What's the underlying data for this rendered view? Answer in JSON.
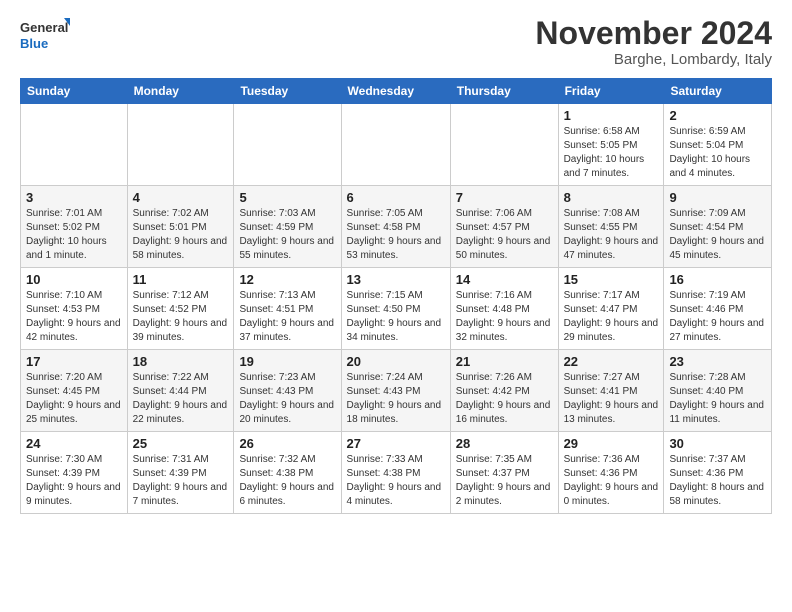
{
  "logo": {
    "line1": "General",
    "line2": "Blue"
  },
  "title": "November 2024",
  "location": "Barghe, Lombardy, Italy",
  "days_header": [
    "Sunday",
    "Monday",
    "Tuesday",
    "Wednesday",
    "Thursday",
    "Friday",
    "Saturday"
  ],
  "weeks": [
    [
      {
        "num": "",
        "info": ""
      },
      {
        "num": "",
        "info": ""
      },
      {
        "num": "",
        "info": ""
      },
      {
        "num": "",
        "info": ""
      },
      {
        "num": "",
        "info": ""
      },
      {
        "num": "1",
        "info": "Sunrise: 6:58 AM\nSunset: 5:05 PM\nDaylight: 10 hours and 7 minutes."
      },
      {
        "num": "2",
        "info": "Sunrise: 6:59 AM\nSunset: 5:04 PM\nDaylight: 10 hours and 4 minutes."
      }
    ],
    [
      {
        "num": "3",
        "info": "Sunrise: 7:01 AM\nSunset: 5:02 PM\nDaylight: 10 hours and 1 minute."
      },
      {
        "num": "4",
        "info": "Sunrise: 7:02 AM\nSunset: 5:01 PM\nDaylight: 9 hours and 58 minutes."
      },
      {
        "num": "5",
        "info": "Sunrise: 7:03 AM\nSunset: 4:59 PM\nDaylight: 9 hours and 55 minutes."
      },
      {
        "num": "6",
        "info": "Sunrise: 7:05 AM\nSunset: 4:58 PM\nDaylight: 9 hours and 53 minutes."
      },
      {
        "num": "7",
        "info": "Sunrise: 7:06 AM\nSunset: 4:57 PM\nDaylight: 9 hours and 50 minutes."
      },
      {
        "num": "8",
        "info": "Sunrise: 7:08 AM\nSunset: 4:55 PM\nDaylight: 9 hours and 47 minutes."
      },
      {
        "num": "9",
        "info": "Sunrise: 7:09 AM\nSunset: 4:54 PM\nDaylight: 9 hours and 45 minutes."
      }
    ],
    [
      {
        "num": "10",
        "info": "Sunrise: 7:10 AM\nSunset: 4:53 PM\nDaylight: 9 hours and 42 minutes."
      },
      {
        "num": "11",
        "info": "Sunrise: 7:12 AM\nSunset: 4:52 PM\nDaylight: 9 hours and 39 minutes."
      },
      {
        "num": "12",
        "info": "Sunrise: 7:13 AM\nSunset: 4:51 PM\nDaylight: 9 hours and 37 minutes."
      },
      {
        "num": "13",
        "info": "Sunrise: 7:15 AM\nSunset: 4:50 PM\nDaylight: 9 hours and 34 minutes."
      },
      {
        "num": "14",
        "info": "Sunrise: 7:16 AM\nSunset: 4:48 PM\nDaylight: 9 hours and 32 minutes."
      },
      {
        "num": "15",
        "info": "Sunrise: 7:17 AM\nSunset: 4:47 PM\nDaylight: 9 hours and 29 minutes."
      },
      {
        "num": "16",
        "info": "Sunrise: 7:19 AM\nSunset: 4:46 PM\nDaylight: 9 hours and 27 minutes."
      }
    ],
    [
      {
        "num": "17",
        "info": "Sunrise: 7:20 AM\nSunset: 4:45 PM\nDaylight: 9 hours and 25 minutes."
      },
      {
        "num": "18",
        "info": "Sunrise: 7:22 AM\nSunset: 4:44 PM\nDaylight: 9 hours and 22 minutes."
      },
      {
        "num": "19",
        "info": "Sunrise: 7:23 AM\nSunset: 4:43 PM\nDaylight: 9 hours and 20 minutes."
      },
      {
        "num": "20",
        "info": "Sunrise: 7:24 AM\nSunset: 4:43 PM\nDaylight: 9 hours and 18 minutes."
      },
      {
        "num": "21",
        "info": "Sunrise: 7:26 AM\nSunset: 4:42 PM\nDaylight: 9 hours and 16 minutes."
      },
      {
        "num": "22",
        "info": "Sunrise: 7:27 AM\nSunset: 4:41 PM\nDaylight: 9 hours and 13 minutes."
      },
      {
        "num": "23",
        "info": "Sunrise: 7:28 AM\nSunset: 4:40 PM\nDaylight: 9 hours and 11 minutes."
      }
    ],
    [
      {
        "num": "24",
        "info": "Sunrise: 7:30 AM\nSunset: 4:39 PM\nDaylight: 9 hours and 9 minutes."
      },
      {
        "num": "25",
        "info": "Sunrise: 7:31 AM\nSunset: 4:39 PM\nDaylight: 9 hours and 7 minutes."
      },
      {
        "num": "26",
        "info": "Sunrise: 7:32 AM\nSunset: 4:38 PM\nDaylight: 9 hours and 6 minutes."
      },
      {
        "num": "27",
        "info": "Sunrise: 7:33 AM\nSunset: 4:38 PM\nDaylight: 9 hours and 4 minutes."
      },
      {
        "num": "28",
        "info": "Sunrise: 7:35 AM\nSunset: 4:37 PM\nDaylight: 9 hours and 2 minutes."
      },
      {
        "num": "29",
        "info": "Sunrise: 7:36 AM\nSunset: 4:36 PM\nDaylight: 9 hours and 0 minutes."
      },
      {
        "num": "30",
        "info": "Sunrise: 7:37 AM\nSunset: 4:36 PM\nDaylight: 8 hours and 58 minutes."
      }
    ]
  ]
}
